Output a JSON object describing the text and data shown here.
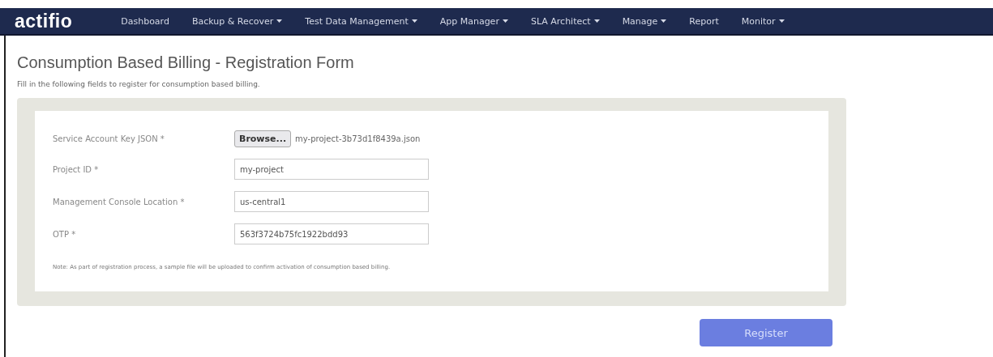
{
  "navbar": {
    "logo": "actifio",
    "items": [
      {
        "label": "Dashboard",
        "dropdown": false
      },
      {
        "label": "Backup & Recover",
        "dropdown": true
      },
      {
        "label": "Test Data Management",
        "dropdown": true
      },
      {
        "label": "App Manager",
        "dropdown": true
      },
      {
        "label": "SLA Architect",
        "dropdown": true
      },
      {
        "label": "Manage",
        "dropdown": true
      },
      {
        "label": "Report",
        "dropdown": false
      },
      {
        "label": "Monitor",
        "dropdown": true
      }
    ]
  },
  "page": {
    "title": "Consumption Based Billing - Registration Form",
    "subtitle": "Fill in the following fields to register for consumption based billing."
  },
  "form": {
    "fields": [
      {
        "kind": "file",
        "label": "Service Account Key JSON",
        "required_mark": "*",
        "button": "Browse...",
        "value": "my-project-3b73d1f8439a.json"
      },
      {
        "kind": "text",
        "label": "Project ID",
        "required_mark": "*",
        "value": "my-project"
      },
      {
        "kind": "text",
        "label": "Management Console Location",
        "required_mark": "*",
        "value": "us-central1"
      },
      {
        "kind": "text",
        "label": "OTP",
        "required_mark": "*",
        "value": "563f3724b75fc1922bdd93"
      }
    ],
    "note": "Note: As part of registration process, a sample file will be uploaded to confirm activation of consumption based billing."
  },
  "submit": {
    "label": "Register"
  }
}
